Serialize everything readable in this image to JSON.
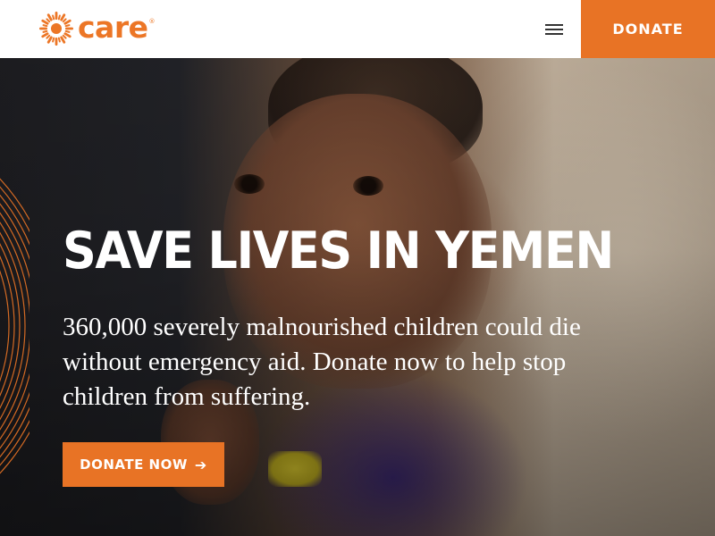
{
  "header": {
    "logo_text": "care",
    "logo_reg": "®",
    "menu_icon": "hamburger-menu-icon",
    "donate_label": "DONATE"
  },
  "hero": {
    "headline": "SAVE LIVES IN YEMEN",
    "subtext": "360,000 severely malnourished children could die without emergency aid. Donate now to help stop children from suffering.",
    "cta_label": "DONATE NOW",
    "cta_icon": "arrow-right-icon"
  },
  "colors": {
    "brand_orange": "#e87325",
    "text_white": "#ffffff",
    "header_bg": "#ffffff"
  }
}
